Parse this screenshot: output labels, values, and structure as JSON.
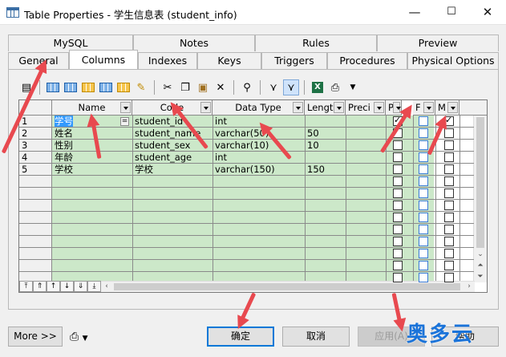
{
  "window": {
    "title": "Table Properties - 学生信息表 (student_info)",
    "minimize": "—",
    "maximize": "☐",
    "close": "✕"
  },
  "tabs": {
    "row1": [
      {
        "label": "MySQL"
      },
      {
        "label": "Notes"
      },
      {
        "label": "Rules"
      },
      {
        "label": "Preview"
      }
    ],
    "row2": [
      {
        "label": "General"
      },
      {
        "label": "Columns",
        "active": true
      },
      {
        "label": "Indexes"
      },
      {
        "label": "Keys"
      },
      {
        "label": "Triggers"
      },
      {
        "label": "Procedures"
      },
      {
        "label": "Physical Options"
      }
    ]
  },
  "toolbar": {
    "icons": [
      "properties-icon",
      "insert-row-icon",
      "add-row-icon",
      "delete-row-icon",
      "add-column-icon",
      "tools-icon",
      "cut-icon",
      "copy-icon",
      "paste-icon",
      "delete-icon",
      "find-icon",
      "filter-icon",
      "customize-columns-icon",
      "excel-icon",
      "print-icon"
    ]
  },
  "grid": {
    "headers": [
      {
        "label": "Name"
      },
      {
        "label": "Code"
      },
      {
        "label": "Data Type"
      },
      {
        "label": "Lengt"
      },
      {
        "label": "Preci"
      },
      {
        "label": "P"
      },
      {
        "label": "F"
      },
      {
        "label": "M"
      }
    ],
    "rows": [
      {
        "num": "1",
        "name": "学号",
        "code": "student_id",
        "type": "int",
        "length": "",
        "p": true,
        "f": false,
        "m": true
      },
      {
        "num": "2",
        "name": "姓名",
        "code": "student_name",
        "type": "varchar(50)",
        "length": "50",
        "p": false,
        "f": false,
        "m": false
      },
      {
        "num": "3",
        "name": "性别",
        "code": "student_sex",
        "type": "varchar(10)",
        "length": "10",
        "p": false,
        "f": false,
        "m": false
      },
      {
        "num": "4",
        "name": "年龄",
        "code": "student_age",
        "type": "int",
        "length": "",
        "p": false,
        "f": false,
        "m": false
      },
      {
        "num": "5",
        "name": "学校",
        "code": "学校",
        "type": "varchar(150)",
        "length": "150",
        "p": false,
        "f": false,
        "m": false
      }
    ],
    "edit_button": "=",
    "nav_buttons": [
      "⤒",
      "⇑",
      "↑",
      "↓",
      "⇓",
      "⤓"
    ]
  },
  "footer": {
    "more": "More >>",
    "ok": "确定",
    "cancel": "取消",
    "apply": "应用(A)",
    "help": "帮助"
  },
  "watermark": "奥多云",
  "colors": {
    "green_cells": "#cce8c9",
    "selection": "#3399ff",
    "annotation_arrow": "#e8494f",
    "watermark": "#1a73d9"
  }
}
